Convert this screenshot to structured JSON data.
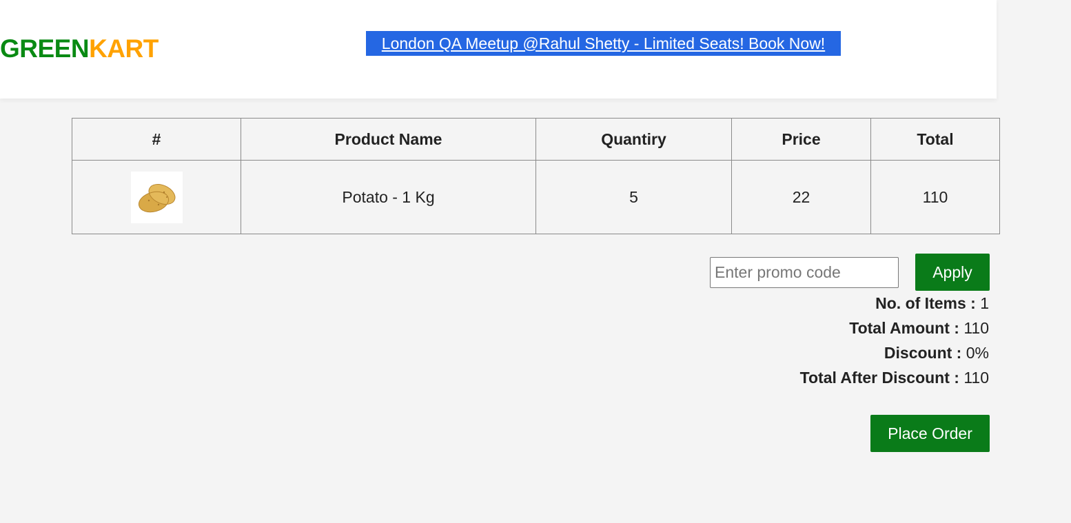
{
  "header": {
    "brand_part1": "GREEN",
    "brand_part2": "KART",
    "promo_banner": "London QA Meetup @Rahul Shetty - Limited Seats! Book Now!"
  },
  "table": {
    "headers": [
      "#",
      "Product Name",
      "Quantiry",
      "Price",
      "Total"
    ],
    "rows": [
      {
        "image_icon": "potato-image",
        "product_name": "Potato - 1 Kg",
        "quantity": "5",
        "price": "22",
        "total": "110"
      }
    ]
  },
  "promo": {
    "placeholder": "Enter promo code",
    "value": "",
    "apply_label": "Apply"
  },
  "summary": {
    "items_label": "No. of Items :",
    "items_value": "1",
    "total_amount_label": "Total Amount :",
    "total_amount_value": "110",
    "discount_label": "Discount :",
    "discount_value": "0%",
    "total_after_discount_label": "Total After Discount :",
    "total_after_discount_value": "110"
  },
  "place_order_label": "Place Order",
  "colors": {
    "brand_green": "#0a8a13",
    "brand_orange": "#ffa200",
    "banner_blue": "#2567e3",
    "button_green": "#0a7b19",
    "page_bg": "#f4f4f4"
  }
}
